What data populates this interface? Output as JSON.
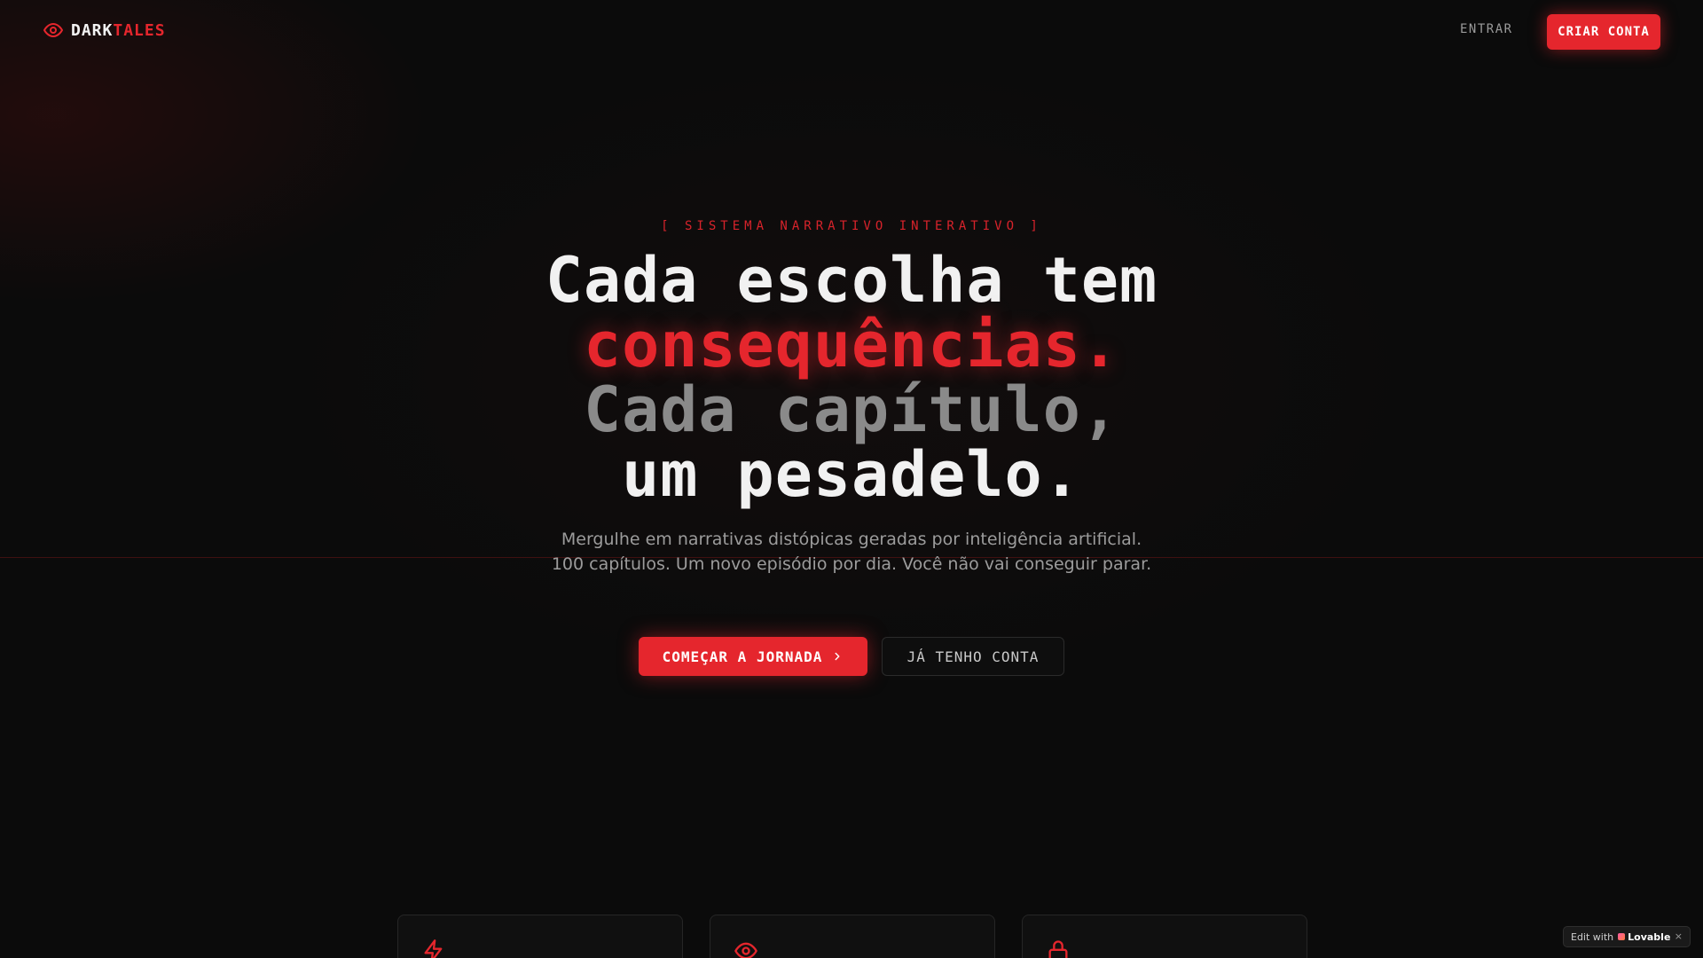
{
  "header": {
    "logo_part1": "DARK",
    "logo_part2": "TALES",
    "login_label": "ENTRAR",
    "signup_label": "CRIAR CONTA"
  },
  "hero": {
    "tag": "[ SISTEMA NARRATIVO INTERATIVO ]",
    "title_line1": "Cada escolha tem",
    "title_line2": "consequências.",
    "title_line3": "Cada capítulo,",
    "title_line4": "um pesadelo.",
    "subtitle": "Mergulhe em narrativas distópicas geradas por inteligência artificial. 100 capítulos. Um novo episódio por dia. Você não vai conseguir parar.",
    "cta_primary": "COMEÇAR A JORNADA",
    "cta_secondary": "JÁ TENHO CONTA"
  },
  "features": {
    "icons": [
      "lightning-icon",
      "eye-icon",
      "lock-icon"
    ]
  },
  "badge": {
    "prefix": "Edit with",
    "brand": "Lovable",
    "close": "×"
  },
  "colors": {
    "accent": "#e5262d",
    "background": "#0b0b0b",
    "muted_text": "#9c9c9c"
  }
}
